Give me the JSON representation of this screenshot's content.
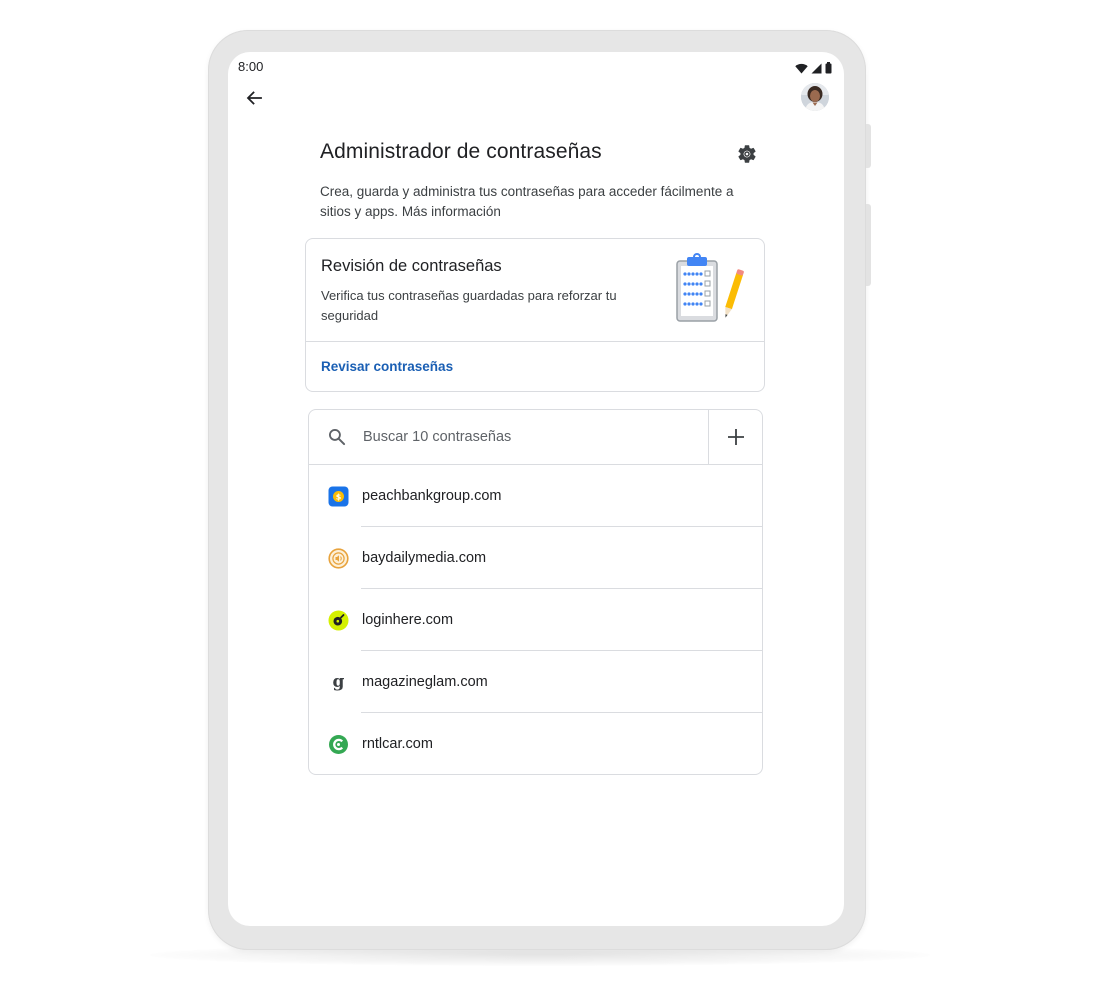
{
  "status_bar": {
    "time": "8:00",
    "icons": [
      "wifi-icon",
      "signal-icon",
      "battery-icon"
    ]
  },
  "app_bar": {
    "back_icon": "arrow-back-icon",
    "avatar": "user-avatar"
  },
  "page": {
    "title": "Administrador de contraseñas",
    "settings_icon": "gear-icon",
    "description": "Crea, guarda y administra tus contraseñas para acceder fácilmente a sitios y apps.",
    "more_info_link": "Más información"
  },
  "checkup": {
    "title": "Revisión de contraseñas",
    "description": "Verifica tus contraseñas guardadas para reforzar tu seguridad",
    "link_label": "Revisar contraseñas",
    "illustration": "clipboard-checklist-pencil"
  },
  "search": {
    "placeholder": "Buscar 10 contraseñas",
    "value": "",
    "add_icon": "plus-icon"
  },
  "passwords": [
    {
      "site": "peachbankgroup.com",
      "icon": "peachbank-icon",
      "color": "#1a73e8"
    },
    {
      "site": "baydailymedia.com",
      "icon": "baydailymedia-icon",
      "color": "#e8a33d"
    },
    {
      "site": "loginhere.com",
      "icon": "loginhere-icon",
      "color": "#d4f000"
    },
    {
      "site": "magazineglam.com",
      "icon": "magazineglam-icon",
      "color": "#3c4043"
    },
    {
      "site": "rntlcar.com",
      "icon": "rntlcar-icon",
      "color": "#34a853"
    }
  ],
  "colors": {
    "link_blue": "#1a5fb4",
    "divider": "#dadce0",
    "text_primary": "#202124",
    "text_secondary": "#3c4043"
  }
}
